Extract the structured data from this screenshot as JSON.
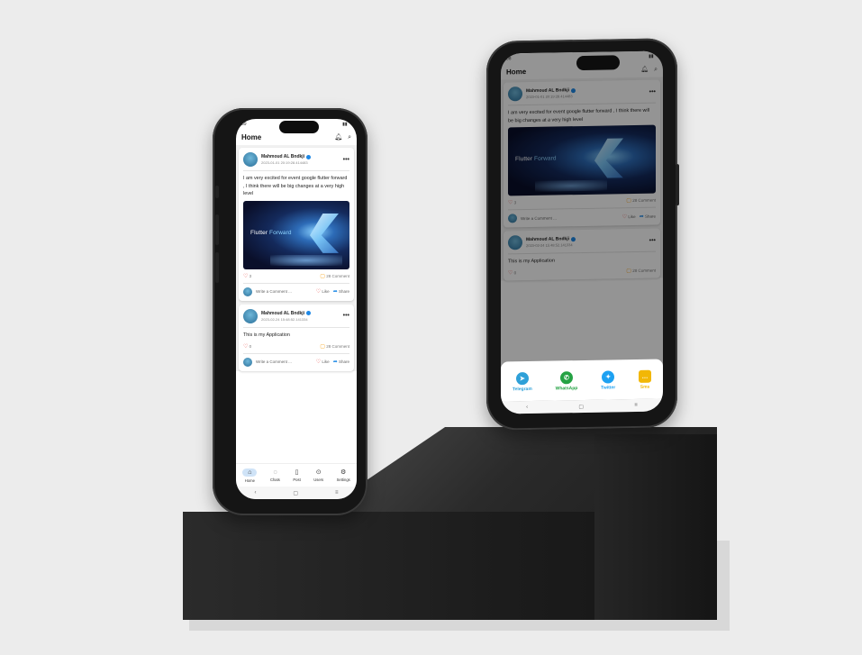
{
  "colors": {
    "accent": "#1e88e5",
    "like": "#e53935",
    "comment": "#f9a825",
    "telegram": "#2ea0d8",
    "whatsapp": "#25a244",
    "twitter": "#1da1f2",
    "sms": "#f2b705"
  },
  "status": {
    "time_left": "89",
    "time_right": "08"
  },
  "app": {
    "title": "Home"
  },
  "posts": [
    {
      "author": "Mahmoud AL Bndkji",
      "date": "2023-01-01 20:19:28.414483",
      "text": "I am very excited for event google flutter forward , I think there will be big changes at a very high level",
      "image": {
        "brand": "Flutter",
        "event": "Forward"
      },
      "likes": "3",
      "comments": "28 Comment"
    },
    {
      "author": "Mahmoud AL Bndkji",
      "date": "2023-02-24 15:48:52.141334",
      "text": "This is my Application",
      "likes": "0",
      "comments": "28 Comment"
    }
  ],
  "actions": {
    "write_placeholder": "Write a Comment ...",
    "like": "Like",
    "share": "Share"
  },
  "bottom_nav": [
    "Home",
    "Chats",
    "Post",
    "Users",
    "Settings"
  ],
  "share_sheet": [
    "Telegram",
    "WhatsApp",
    "Twitter",
    "Sms"
  ],
  "icons": {
    "notification": "bell-icon",
    "search": "search-icon",
    "more": "more-dots-icon"
  }
}
